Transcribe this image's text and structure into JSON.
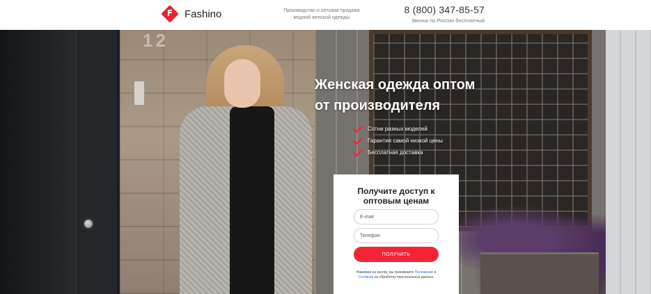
{
  "header": {
    "brand": "Fashino",
    "logo_letter": "F",
    "tagline": "Производство и оптовая продажа модной женской одежды",
    "phone": "8 (800) 347-85-57",
    "phone_note": "Звонок по России бесплатный"
  },
  "hero": {
    "house_number": "12",
    "title_line1": "Женская одежда оптом",
    "title_line2": "от производителя",
    "benefits": [
      "Сотни разных моделей",
      "Гарантия самой низкой цены",
      "Бесплатная доставка"
    ]
  },
  "form": {
    "title": "Получите доступ к оптовым ценам",
    "email_placeholder": "E-mail",
    "phone_placeholder": "Телефон",
    "submit_label": "ПОЛУЧИТЬ",
    "consent_prefix": "Нажимая на кнопку, вы принимаете",
    "consent_link1": "Положение",
    "consent_and": "и",
    "consent_link2": "Согласие",
    "consent_suffix": "на обработку персональных данных."
  },
  "colors": {
    "accent": "#e8232f",
    "button": "#f42436",
    "link": "#2b6cd4"
  },
  "icons": [
    "logo-diamond-icon",
    "check-icon"
  ]
}
